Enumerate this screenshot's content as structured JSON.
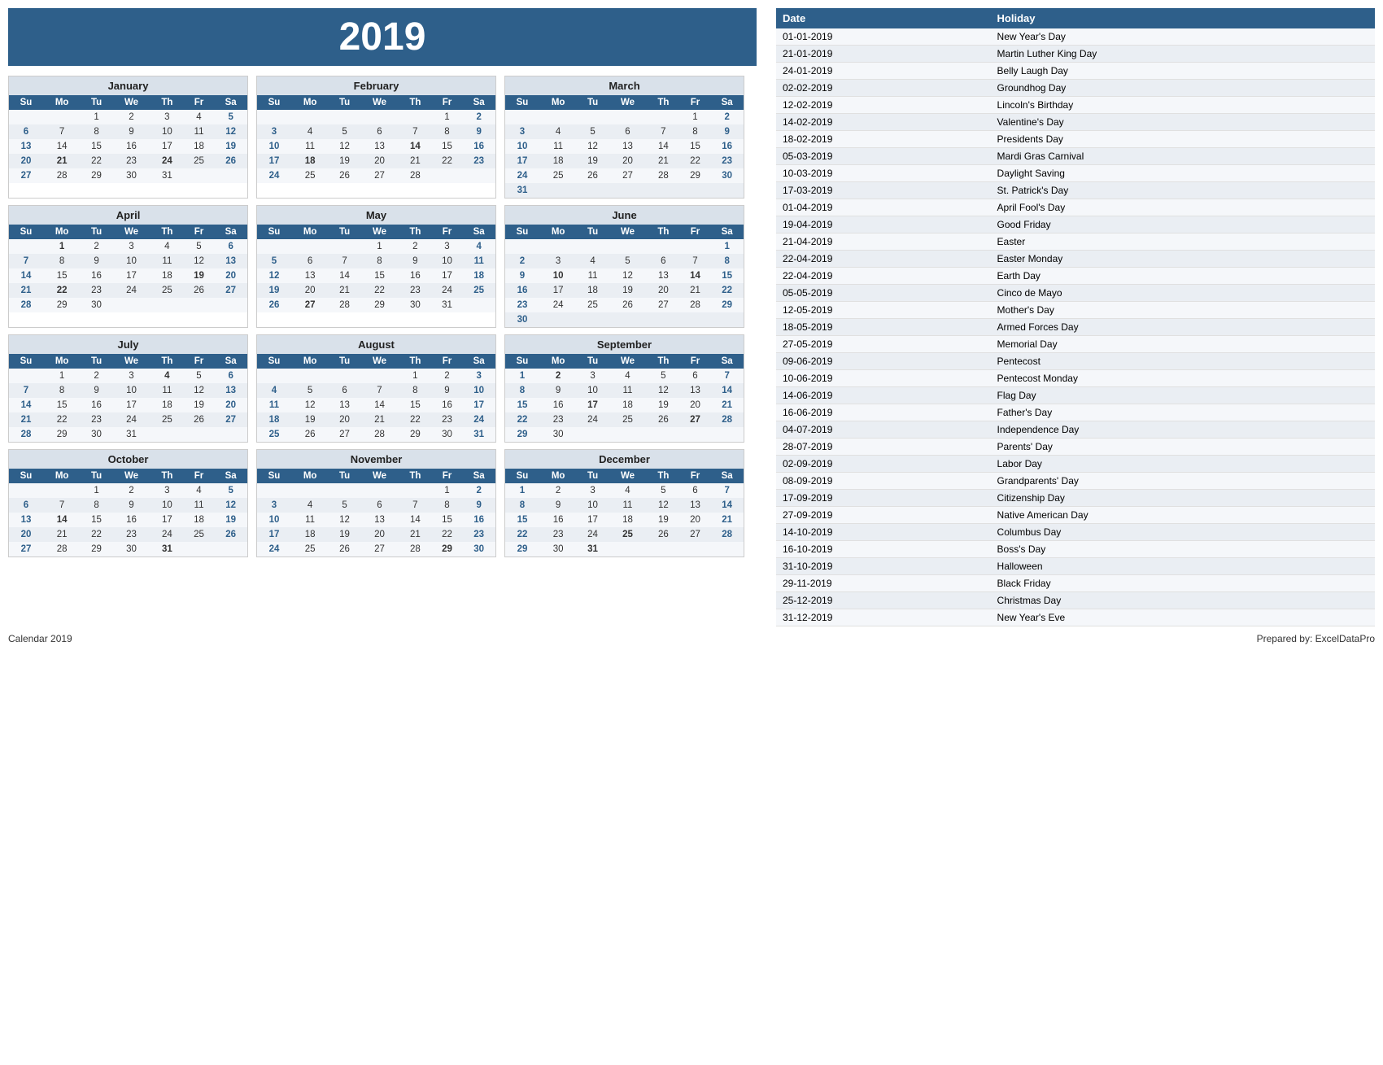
{
  "title": "2019",
  "months": [
    {
      "name": "January",
      "days_header": [
        "Su",
        "Mo",
        "Tu",
        "We",
        "Th",
        "Fr",
        "Sa"
      ],
      "weeks": [
        [
          "",
          "",
          "1",
          "2",
          "3",
          "4",
          "5"
        ],
        [
          "6",
          "7",
          "8",
          "9",
          "10",
          "11",
          "12"
        ],
        [
          "13",
          "14",
          "15",
          "16",
          "17",
          "18",
          "19"
        ],
        [
          "20",
          "21",
          "22",
          "23",
          "24",
          "25",
          "26"
        ],
        [
          "27",
          "28",
          "29",
          "30",
          "31",
          "",
          ""
        ]
      ],
      "bold": [
        "5",
        "12",
        "19",
        "26",
        "21",
        "24"
      ],
      "highlight_su": [
        "6",
        "13",
        "20",
        "27"
      ],
      "highlight_sa": [
        "5",
        "12",
        "19",
        "26"
      ]
    },
    {
      "name": "February",
      "days_header": [
        "Su",
        "Mo",
        "Tu",
        "We",
        "Th",
        "Fr",
        "Sa"
      ],
      "weeks": [
        [
          "",
          "",
          "",
          "",
          "",
          "1",
          "2"
        ],
        [
          "3",
          "4",
          "5",
          "6",
          "7",
          "8",
          "9"
        ],
        [
          "10",
          "11",
          "12",
          "13",
          "14",
          "15",
          "16"
        ],
        [
          "17",
          "18",
          "19",
          "20",
          "21",
          "22",
          "23"
        ],
        [
          "24",
          "25",
          "26",
          "27",
          "28",
          "",
          ""
        ]
      ],
      "bold": [
        "2",
        "9",
        "16",
        "23",
        "14",
        "18"
      ],
      "highlight_su": [
        "3",
        "10",
        "17",
        "24"
      ],
      "highlight_sa": [
        "2",
        "9",
        "16",
        "23"
      ]
    },
    {
      "name": "March",
      "days_header": [
        "Su",
        "Mo",
        "Tu",
        "We",
        "Th",
        "Fr",
        "Sa"
      ],
      "weeks": [
        [
          "",
          "",
          "",
          "",
          "",
          "1",
          "2"
        ],
        [
          "3",
          "4",
          "5",
          "6",
          "7",
          "8",
          "9"
        ],
        [
          "10",
          "11",
          "12",
          "13",
          "14",
          "15",
          "16"
        ],
        [
          "17",
          "18",
          "19",
          "20",
          "21",
          "22",
          "23"
        ],
        [
          "24",
          "25",
          "26",
          "27",
          "28",
          "29",
          "30"
        ],
        [
          "31",
          "",
          "",
          "",
          "",
          "",
          ""
        ]
      ],
      "bold": [
        "2",
        "9",
        "16",
        "23",
        "30"
      ],
      "highlight_su": [
        "3",
        "10",
        "17",
        "24",
        "31"
      ],
      "highlight_sa": [
        "2",
        "9",
        "16",
        "23",
        "30"
      ]
    },
    {
      "name": "April",
      "days_header": [
        "Su",
        "Mo",
        "Tu",
        "We",
        "Th",
        "Fr",
        "Sa"
      ],
      "weeks": [
        [
          "",
          "1",
          "2",
          "3",
          "4",
          "5",
          "6"
        ],
        [
          "7",
          "8",
          "9",
          "10",
          "11",
          "12",
          "13"
        ],
        [
          "14",
          "15",
          "16",
          "17",
          "18",
          "19",
          "20"
        ],
        [
          "21",
          "22",
          "23",
          "24",
          "25",
          "26",
          "27"
        ],
        [
          "28",
          "29",
          "30",
          "",
          "",
          "",
          ""
        ]
      ],
      "bold": [
        "6",
        "13",
        "20",
        "27",
        "1",
        "19",
        "22"
      ],
      "highlight_su": [
        "7",
        "14",
        "21",
        "28"
      ],
      "highlight_sa": [
        "6",
        "13",
        "20",
        "27"
      ]
    },
    {
      "name": "May",
      "days_header": [
        "Su",
        "Mo",
        "Tu",
        "We",
        "Th",
        "Fr",
        "Sa"
      ],
      "weeks": [
        [
          "",
          "",
          "",
          "1",
          "2",
          "3",
          "4"
        ],
        [
          "5",
          "6",
          "7",
          "8",
          "9",
          "10",
          "11"
        ],
        [
          "12",
          "13",
          "14",
          "15",
          "16",
          "17",
          "18"
        ],
        [
          "19",
          "20",
          "21",
          "22",
          "23",
          "24",
          "25"
        ],
        [
          "26",
          "27",
          "28",
          "29",
          "30",
          "31",
          ""
        ]
      ],
      "bold": [
        "4",
        "11",
        "18",
        "25",
        "12",
        "27"
      ],
      "highlight_su": [
        "5",
        "12",
        "19",
        "26"
      ],
      "highlight_sa": [
        "4",
        "11",
        "18",
        "25"
      ]
    },
    {
      "name": "June",
      "days_header": [
        "Su",
        "Mo",
        "Tu",
        "We",
        "Th",
        "Fr",
        "Sa"
      ],
      "weeks": [
        [
          "",
          "",
          "",
          "",
          "",
          "",
          "1"
        ],
        [
          "2",
          "3",
          "4",
          "5",
          "6",
          "7",
          "8"
        ],
        [
          "9",
          "10",
          "11",
          "12",
          "13",
          "14",
          "15"
        ],
        [
          "16",
          "17",
          "18",
          "19",
          "20",
          "21",
          "22"
        ],
        [
          "23",
          "24",
          "25",
          "26",
          "27",
          "28",
          "29"
        ],
        [
          "30",
          "",
          "",
          "",
          "",
          "",
          ""
        ]
      ],
      "bold": [
        "1",
        "8",
        "15",
        "22",
        "29",
        "10",
        "14",
        "16"
      ],
      "highlight_su": [
        "2",
        "9",
        "16",
        "23",
        "30"
      ],
      "highlight_sa": [
        "1",
        "8",
        "15",
        "22",
        "29"
      ]
    },
    {
      "name": "July",
      "days_header": [
        "Su",
        "Mo",
        "Tu",
        "We",
        "Th",
        "Fr",
        "Sa"
      ],
      "weeks": [
        [
          "",
          "1",
          "2",
          "3",
          "4",
          "5",
          "6"
        ],
        [
          "7",
          "8",
          "9",
          "10",
          "11",
          "12",
          "13"
        ],
        [
          "14",
          "15",
          "16",
          "17",
          "18",
          "19",
          "20"
        ],
        [
          "21",
          "22",
          "23",
          "24",
          "25",
          "26",
          "27"
        ],
        [
          "28",
          "29",
          "30",
          "31",
          "",
          "",
          ""
        ]
      ],
      "bold": [
        "6",
        "13",
        "20",
        "27",
        "4"
      ],
      "highlight_su": [
        "7",
        "14",
        "21",
        "28"
      ],
      "highlight_sa": [
        "6",
        "13",
        "20",
        "27"
      ]
    },
    {
      "name": "August",
      "days_header": [
        "Su",
        "Mo",
        "Tu",
        "We",
        "Th",
        "Fr",
        "Sa"
      ],
      "weeks": [
        [
          "",
          "",
          "",
          "",
          "1",
          "2",
          "3"
        ],
        [
          "4",
          "5",
          "6",
          "7",
          "8",
          "9",
          "10"
        ],
        [
          "11",
          "12",
          "13",
          "14",
          "15",
          "16",
          "17"
        ],
        [
          "18",
          "19",
          "20",
          "21",
          "22",
          "23",
          "24"
        ],
        [
          "25",
          "26",
          "27",
          "28",
          "29",
          "30",
          "31"
        ]
      ],
      "bold": [
        "3",
        "10",
        "17",
        "24",
        "31"
      ],
      "highlight_su": [
        "4",
        "11",
        "18",
        "25"
      ],
      "highlight_sa": [
        "3",
        "10",
        "17",
        "24",
        "31"
      ]
    },
    {
      "name": "September",
      "days_header": [
        "Su",
        "Mo",
        "Tu",
        "We",
        "Th",
        "Fr",
        "Sa"
      ],
      "weeks": [
        [
          "1",
          "2",
          "3",
          "4",
          "5",
          "6",
          "7"
        ],
        [
          "8",
          "9",
          "10",
          "11",
          "12",
          "13",
          "14"
        ],
        [
          "15",
          "16",
          "17",
          "18",
          "19",
          "20",
          "21"
        ],
        [
          "22",
          "23",
          "24",
          "25",
          "26",
          "27",
          "28"
        ],
        [
          "29",
          "30",
          "",
          "",
          "",
          "",
          ""
        ]
      ],
      "bold": [
        "7",
        "14",
        "21",
        "28",
        "1",
        "2",
        "17",
        "27"
      ],
      "highlight_su": [
        "1",
        "8",
        "15",
        "22",
        "29"
      ],
      "highlight_sa": [
        "7",
        "14",
        "21",
        "28"
      ]
    },
    {
      "name": "October",
      "days_header": [
        "Su",
        "Mo",
        "Tu",
        "We",
        "Th",
        "Fr",
        "Sa"
      ],
      "weeks": [
        [
          "",
          "",
          "1",
          "2",
          "3",
          "4",
          "5"
        ],
        [
          "6",
          "7",
          "8",
          "9",
          "10",
          "11",
          "12"
        ],
        [
          "13",
          "14",
          "15",
          "16",
          "17",
          "18",
          "19"
        ],
        [
          "20",
          "21",
          "22",
          "23",
          "24",
          "25",
          "26"
        ],
        [
          "27",
          "28",
          "29",
          "30",
          "31",
          "",
          ""
        ]
      ],
      "bold": [
        "5",
        "12",
        "19",
        "26",
        "14",
        "31"
      ],
      "highlight_su": [
        "6",
        "13",
        "20",
        "27"
      ],
      "highlight_sa": [
        "5",
        "12",
        "19",
        "26"
      ]
    },
    {
      "name": "November",
      "days_header": [
        "Su",
        "Mo",
        "Tu",
        "We",
        "Th",
        "Fr",
        "Sa"
      ],
      "weeks": [
        [
          "",
          "",
          "",
          "",
          "",
          "1",
          "2"
        ],
        [
          "3",
          "4",
          "5",
          "6",
          "7",
          "8",
          "9"
        ],
        [
          "10",
          "11",
          "12",
          "13",
          "14",
          "15",
          "16"
        ],
        [
          "17",
          "18",
          "19",
          "20",
          "21",
          "22",
          "23"
        ],
        [
          "24",
          "25",
          "26",
          "27",
          "28",
          "29",
          "30"
        ]
      ],
      "bold": [
        "2",
        "9",
        "16",
        "23",
        "30",
        "29"
      ],
      "highlight_su": [
        "3",
        "10",
        "17",
        "24"
      ],
      "highlight_sa": [
        "2",
        "9",
        "16",
        "23",
        "30"
      ]
    },
    {
      "name": "December",
      "days_header": [
        "Su",
        "Mo",
        "Tu",
        "We",
        "Th",
        "Fr",
        "Sa"
      ],
      "weeks": [
        [
          "1",
          "2",
          "3",
          "4",
          "5",
          "6",
          "7"
        ],
        [
          "8",
          "9",
          "10",
          "11",
          "12",
          "13",
          "14"
        ],
        [
          "15",
          "16",
          "17",
          "18",
          "19",
          "20",
          "21"
        ],
        [
          "22",
          "23",
          "24",
          "25",
          "26",
          "27",
          "28"
        ],
        [
          "29",
          "30",
          "31",
          "",
          "",
          "",
          ""
        ]
      ],
      "bold": [
        "7",
        "14",
        "21",
        "28",
        "1",
        "25",
        "31"
      ],
      "highlight_su": [
        "1",
        "8",
        "15",
        "22",
        "29"
      ],
      "highlight_sa": [
        "7",
        "14",
        "21",
        "28"
      ]
    }
  ],
  "holiday_table": {
    "headers": [
      "Date",
      "Holiday"
    ],
    "rows": [
      [
        "01-01-2019",
        "New Year's Day"
      ],
      [
        "21-01-2019",
        "Martin Luther King Day"
      ],
      [
        "24-01-2019",
        "Belly Laugh Day"
      ],
      [
        "02-02-2019",
        "Groundhog Day"
      ],
      [
        "12-02-2019",
        "Lincoln's Birthday"
      ],
      [
        "14-02-2019",
        "Valentine's Day"
      ],
      [
        "18-02-2019",
        "Presidents Day"
      ],
      [
        "05-03-2019",
        "Mardi Gras Carnival"
      ],
      [
        "10-03-2019",
        "Daylight Saving"
      ],
      [
        "17-03-2019",
        "St. Patrick's Day"
      ],
      [
        "01-04-2019",
        "April Fool's Day"
      ],
      [
        "19-04-2019",
        "Good Friday"
      ],
      [
        "21-04-2019",
        "Easter"
      ],
      [
        "22-04-2019",
        "Easter Monday"
      ],
      [
        "22-04-2019",
        "Earth Day"
      ],
      [
        "05-05-2019",
        "Cinco de Mayo"
      ],
      [
        "12-05-2019",
        "Mother's Day"
      ],
      [
        "18-05-2019",
        "Armed Forces Day"
      ],
      [
        "27-05-2019",
        "Memorial Day"
      ],
      [
        "09-06-2019",
        "Pentecost"
      ],
      [
        "10-06-2019",
        "Pentecost Monday"
      ],
      [
        "14-06-2019",
        "Flag Day"
      ],
      [
        "16-06-2019",
        "Father's Day"
      ],
      [
        "04-07-2019",
        "Independence Day"
      ],
      [
        "28-07-2019",
        "Parents' Day"
      ],
      [
        "02-09-2019",
        "Labor Day"
      ],
      [
        "08-09-2019",
        "Grandparents' Day"
      ],
      [
        "17-09-2019",
        "Citizenship Day"
      ],
      [
        "27-09-2019",
        "Native American Day"
      ],
      [
        "14-10-2019",
        "Columbus Day"
      ],
      [
        "16-10-2019",
        "Boss's Day"
      ],
      [
        "31-10-2019",
        "Halloween"
      ],
      [
        "29-11-2019",
        "Black Friday"
      ],
      [
        "25-12-2019",
        "Christmas Day"
      ],
      [
        "31-12-2019",
        "New Year's Eve"
      ]
    ]
  },
  "footer": {
    "left": "Calendar 2019",
    "right": "Prepared by: ExcelDataPro"
  }
}
